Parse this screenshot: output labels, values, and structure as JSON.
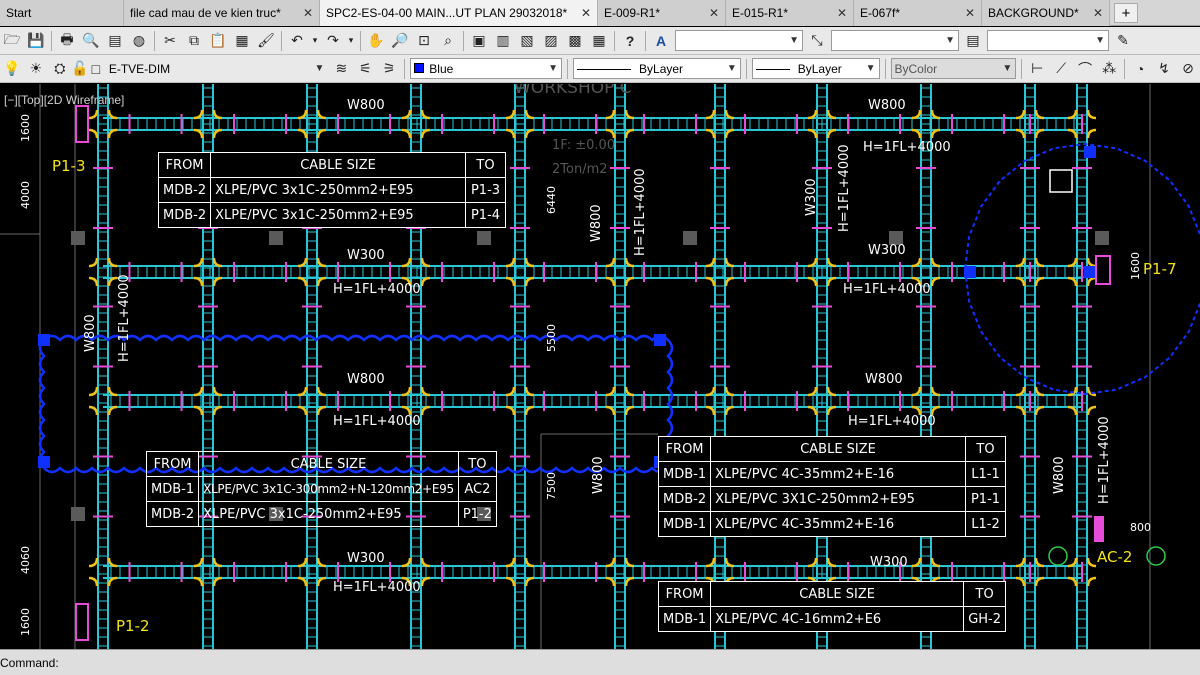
{
  "tabs": [
    {
      "label": "Start",
      "active": false,
      "closable": false
    },
    {
      "label": "file cad mau de ve kien truc*",
      "active": false,
      "closable": true
    },
    {
      "label": "SPC2-ES-04-00 MAIN...UT PLAN 29032018*",
      "active": true,
      "closable": true
    },
    {
      "label": "E-009-R1*",
      "active": false,
      "closable": true
    },
    {
      "label": "E-015-R1*",
      "active": false,
      "closable": true
    },
    {
      "label": "E-067f*",
      "active": false,
      "closable": true
    },
    {
      "label": "BACKGROUND*",
      "active": false,
      "closable": true
    }
  ],
  "close_glyph": "✕",
  "new_tab_glyph": "+",
  "toolbar1": {
    "icons": [
      "open-icon",
      "save-icon",
      "print-icon",
      "plot-preview-icon",
      "publish-icon",
      "3d-dwf-icon",
      "cut-icon",
      "copy-icon",
      "paste-icon",
      "paste-block-icon",
      "match-properties-icon",
      "undo-icon",
      "redo-icon",
      "pan-icon",
      "zoom-realtime-icon",
      "zoom-window-icon",
      "zoom-previous-icon",
      "properties-icon",
      "design-center-icon",
      "tool-palettes-icon",
      "sheet-set-icon",
      "markup-icon",
      "calculator-icon",
      "help-icon",
      "text-style-icon",
      "multileader-icon",
      "plot-style-icon",
      "brush-icon"
    ],
    "text_style_value": "",
    "dim_style_value": "",
    "table_style_value": ""
  },
  "toolbar2": {
    "layer_name": "E-TVE-DIM",
    "color_value": "Blue",
    "linetype_value": "ByLayer",
    "lineweight_value": "ByLayer",
    "plotstyle_value": "ByColor"
  },
  "viewport_label": "[−][Top][2D Wireframe]",
  "colors": {
    "tray": "#29c6d6",
    "rung": "#e84bd7",
    "fitting": "#f2c21b",
    "revision_cloud": "#1030ff",
    "cad_text": "#ffffff",
    "panel_label": "#f5e31a"
  },
  "drawing": {
    "tray_labels_h": [
      {
        "text": "W800"
      },
      {
        "text": "W800"
      },
      {
        "text": "W300"
      },
      {
        "text": "W300"
      },
      {
        "text": "W800"
      },
      {
        "text": "W800"
      },
      {
        "text": "W300"
      },
      {
        "text": "W300"
      }
    ],
    "height_labels_h": [
      {
        "text": "H=1FL+4000"
      },
      {
        "text": "H=1FL+4000"
      },
      {
        "text": "H=1FL+4000"
      },
      {
        "text": "H=1FL+4000"
      },
      {
        "text": "H=1FL+4000"
      },
      {
        "text": "H=1FL+4000"
      }
    ],
    "vertical_labels": [
      {
        "text": "1600"
      },
      {
        "text": "4000"
      },
      {
        "text": "H=1FL+4000"
      },
      {
        "text": "W800"
      },
      {
        "text": "6440"
      },
      {
        "text": "W800"
      },
      {
        "text": "H=1FL+4000"
      },
      {
        "text": "W300"
      },
      {
        "text": "H=1FL+4000"
      },
      {
        "text": "5500"
      },
      {
        "text": "7500"
      },
      {
        "text": "W800"
      },
      {
        "text": "W800"
      },
      {
        "text": "H=1FL+4000"
      },
      {
        "text": "4060"
      },
      {
        "text": "1600"
      },
      {
        "text": "1600"
      },
      {
        "text": "800"
      }
    ],
    "panel_labels": {
      "p13": "P1-3",
      "p12": "P1-2",
      "p17": "P1-7",
      "ac2": "AC-2"
    },
    "faint_labels": {
      "workshop": "WORKSHOP C",
      "load1": "1F: ±0.00",
      "load2": "2Ton/m2"
    }
  },
  "tables": [
    {
      "id": "table-a",
      "headers": [
        "FROM",
        "CABLE SIZE",
        "TO"
      ],
      "rows": [
        [
          "MDB-2",
          "XLPE/PVC  3x1C-250mm2+E95",
          "P1-3"
        ],
        [
          "MDB-2",
          "XLPE/PVC  3x1C-250mm2+E95",
          "P1-4"
        ]
      ]
    },
    {
      "id": "table-b",
      "headers": [
        "FROM",
        "CABLE SIZE",
        "TO"
      ],
      "rows": [
        [
          "MDB-1",
          "XLPE/PVC  3x1C-300mm2+N-120mm2+E95",
          "AC2"
        ],
        [
          "MDB-2",
          "XLPE/PVC  3x1C-250mm2+E95",
          "P1-2"
        ]
      ]
    },
    {
      "id": "table-c",
      "headers": [
        "FROM",
        "CABLE SIZE",
        "TO"
      ],
      "rows": [
        [
          "MDB-1",
          "XLPE/PVC  4C-35mm2+E-16",
          "L1-1"
        ],
        [
          "MDB-2",
          "XLPE/PVC  3X1C-250mm2+E95",
          "P1-1"
        ],
        [
          "MDB-1",
          "XLPE/PVC  4C-35mm2+E-16",
          "L1-2"
        ]
      ]
    },
    {
      "id": "table-d",
      "headers": [
        "FROM",
        "CABLE SIZE",
        "TO"
      ],
      "rows": [
        [
          "MDB-1",
          "XLPE/PVC  4C-16mm2+E6",
          "GH-2"
        ]
      ]
    }
  ],
  "command_line": {
    "prompt": "Command:",
    "value": ""
  }
}
